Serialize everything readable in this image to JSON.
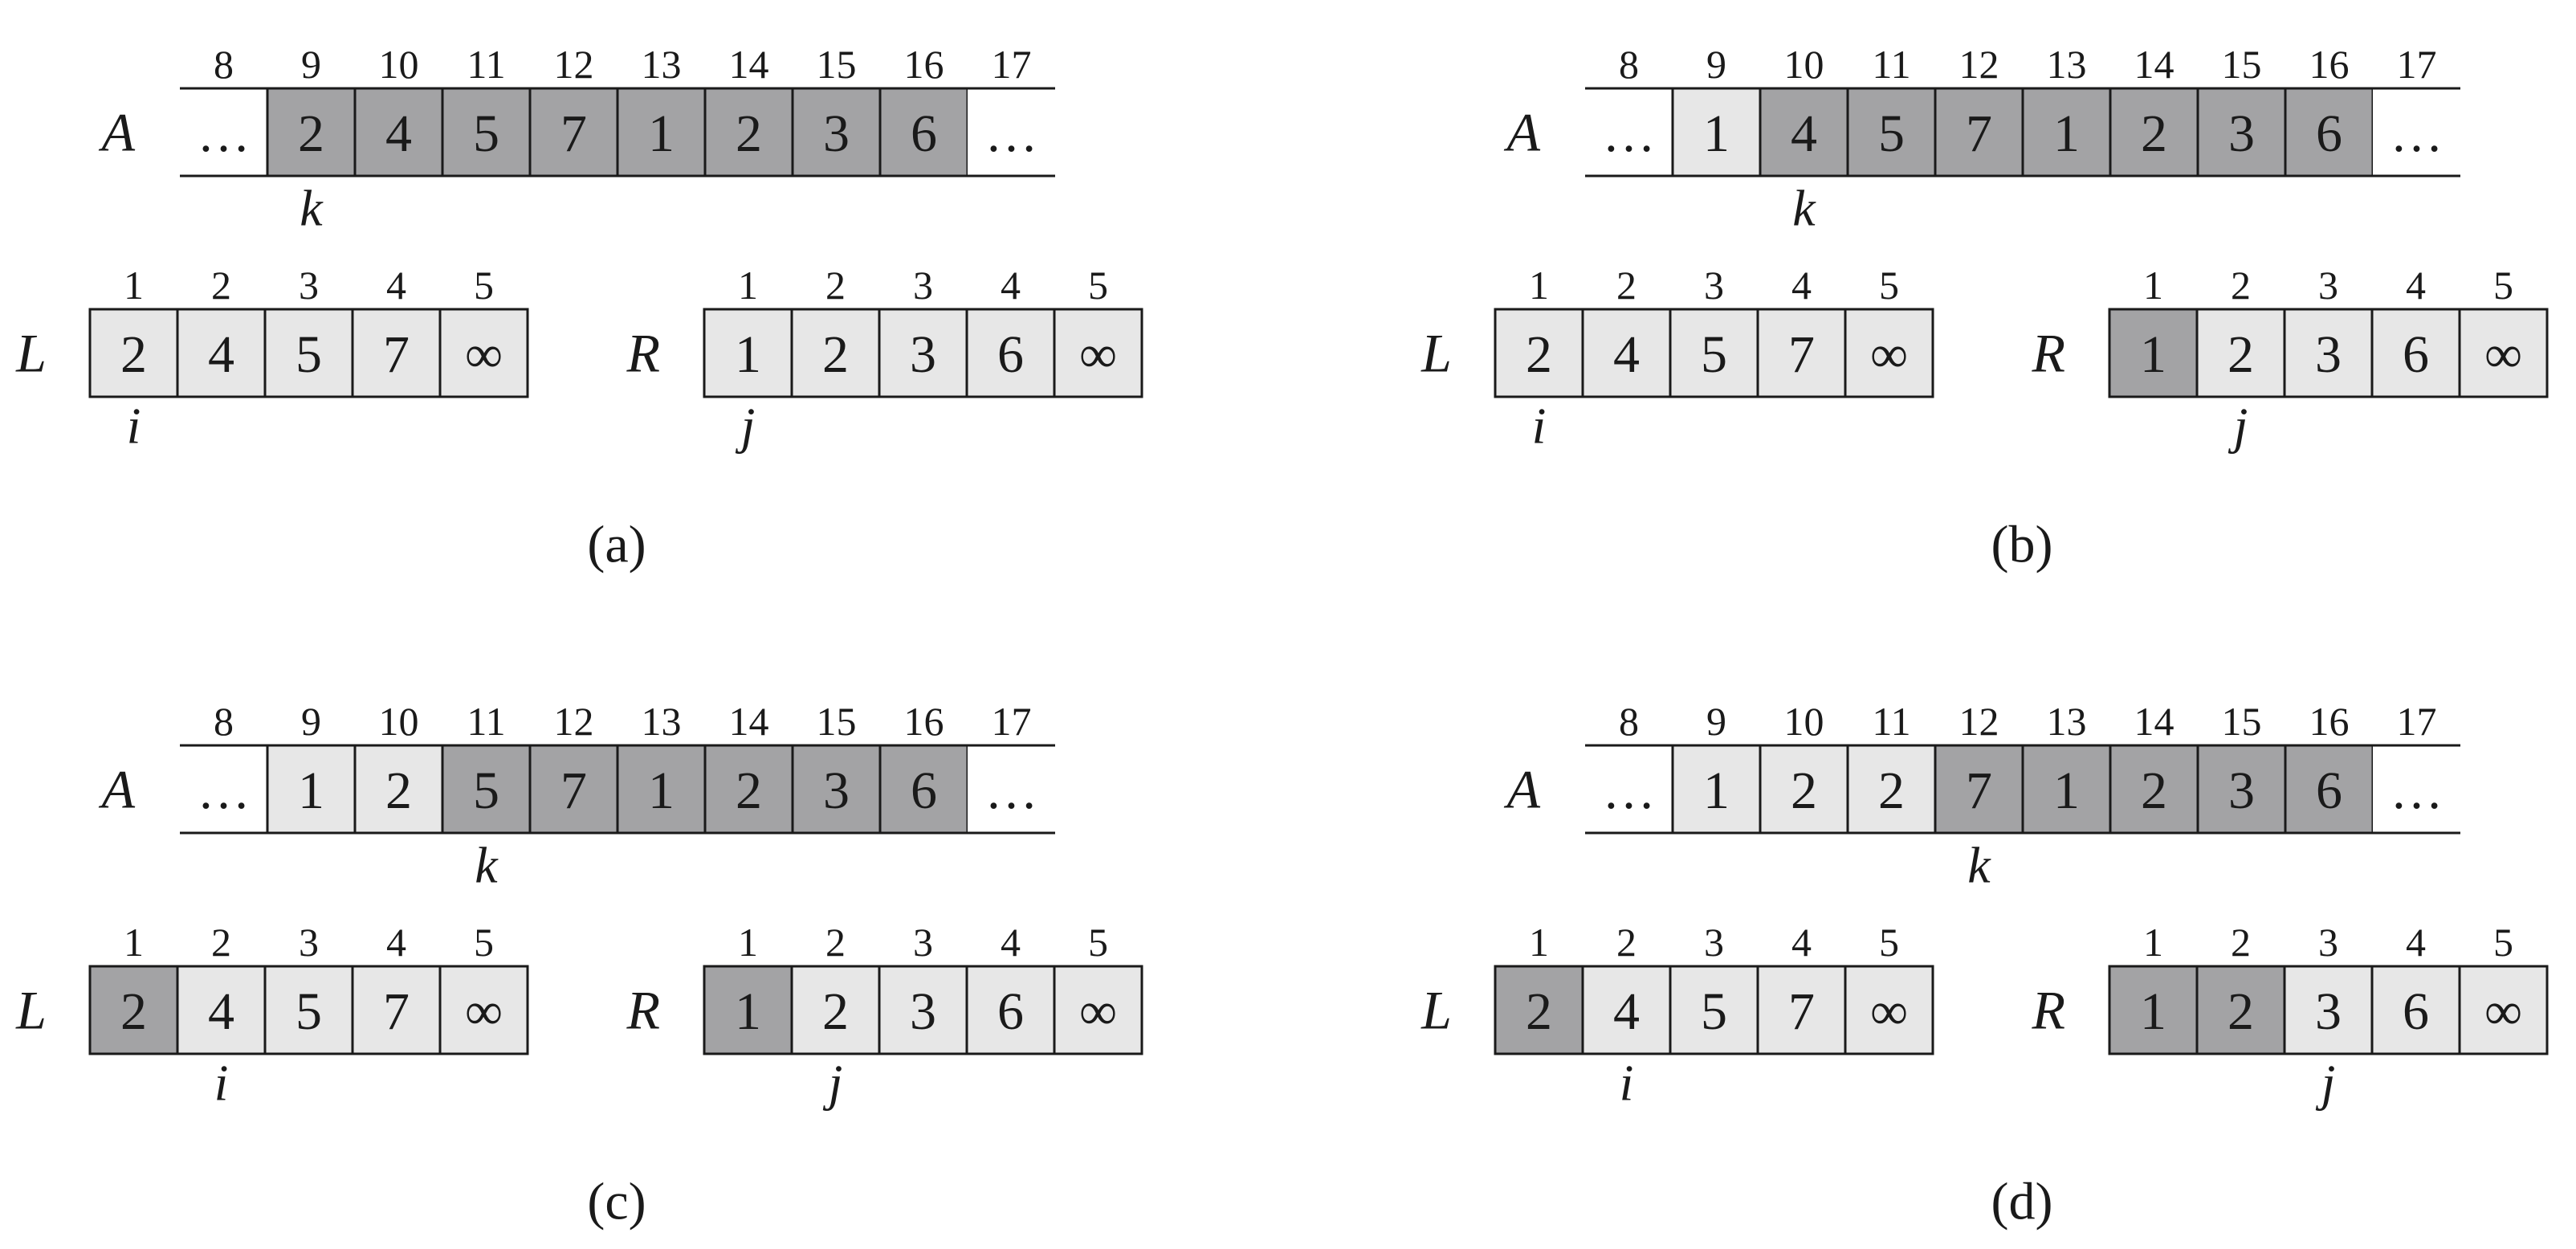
{
  "colors": {
    "dark": "#a3a3a5",
    "light": "#e7e7e7",
    "white": "#ffffff",
    "ink": "#1a1a1a"
  },
  "panels": [
    {
      "caption": "(a)",
      "A": {
        "name": "A",
        "indices": [
          "8",
          "9",
          "10",
          "11",
          "12",
          "13",
          "14",
          "15",
          "16",
          "17"
        ],
        "values": [
          "…",
          "2",
          "4",
          "5",
          "7",
          "1",
          "2",
          "3",
          "6",
          "…"
        ],
        "shades": [
          "white",
          "dark",
          "dark",
          "dark",
          "dark",
          "dark",
          "dark",
          "dark",
          "dark",
          "white"
        ],
        "pointer": {
          "label": "k",
          "cell": 1
        }
      },
      "L": {
        "name": "L",
        "indices": [
          "1",
          "2",
          "3",
          "4",
          "5"
        ],
        "values": [
          "2",
          "4",
          "5",
          "7",
          "∞"
        ],
        "shades": [
          "light",
          "light",
          "light",
          "light",
          "light"
        ],
        "pointer": {
          "label": "i",
          "cell": 0
        }
      },
      "R": {
        "name": "R",
        "indices": [
          "1",
          "2",
          "3",
          "4",
          "5"
        ],
        "values": [
          "1",
          "2",
          "3",
          "6",
          "∞"
        ],
        "shades": [
          "light",
          "light",
          "light",
          "light",
          "light"
        ],
        "pointer": {
          "label": "j",
          "cell": 0
        }
      }
    },
    {
      "caption": "(b)",
      "A": {
        "name": "A",
        "indices": [
          "8",
          "9",
          "10",
          "11",
          "12",
          "13",
          "14",
          "15",
          "16",
          "17"
        ],
        "values": [
          "…",
          "1",
          "4",
          "5",
          "7",
          "1",
          "2",
          "3",
          "6",
          "…"
        ],
        "shades": [
          "white",
          "light",
          "dark",
          "dark",
          "dark",
          "dark",
          "dark",
          "dark",
          "dark",
          "white"
        ],
        "pointer": {
          "label": "k",
          "cell": 2
        }
      },
      "L": {
        "name": "L",
        "indices": [
          "1",
          "2",
          "3",
          "4",
          "5"
        ],
        "values": [
          "2",
          "4",
          "5",
          "7",
          "∞"
        ],
        "shades": [
          "light",
          "light",
          "light",
          "light",
          "light"
        ],
        "pointer": {
          "label": "i",
          "cell": 0
        }
      },
      "R": {
        "name": "R",
        "indices": [
          "1",
          "2",
          "3",
          "4",
          "5"
        ],
        "values": [
          "1",
          "2",
          "3",
          "6",
          "∞"
        ],
        "shades": [
          "dark",
          "light",
          "light",
          "light",
          "light"
        ],
        "pointer": {
          "label": "j",
          "cell": 1
        }
      }
    },
    {
      "caption": "(c)",
      "A": {
        "name": "A",
        "indices": [
          "8",
          "9",
          "10",
          "11",
          "12",
          "13",
          "14",
          "15",
          "16",
          "17"
        ],
        "values": [
          "…",
          "1",
          "2",
          "5",
          "7",
          "1",
          "2",
          "3",
          "6",
          "…"
        ],
        "shades": [
          "white",
          "light",
          "light",
          "dark",
          "dark",
          "dark",
          "dark",
          "dark",
          "dark",
          "white"
        ],
        "pointer": {
          "label": "k",
          "cell": 3
        }
      },
      "L": {
        "name": "L",
        "indices": [
          "1",
          "2",
          "3",
          "4",
          "5"
        ],
        "values": [
          "2",
          "4",
          "5",
          "7",
          "∞"
        ],
        "shades": [
          "dark",
          "light",
          "light",
          "light",
          "light"
        ],
        "pointer": {
          "label": "i",
          "cell": 1
        }
      },
      "R": {
        "name": "R",
        "indices": [
          "1",
          "2",
          "3",
          "4",
          "5"
        ],
        "values": [
          "1",
          "2",
          "3",
          "6",
          "∞"
        ],
        "shades": [
          "dark",
          "light",
          "light",
          "light",
          "light"
        ],
        "pointer": {
          "label": "j",
          "cell": 1
        }
      }
    },
    {
      "caption": "(d)",
      "A": {
        "name": "A",
        "indices": [
          "8",
          "9",
          "10",
          "11",
          "12",
          "13",
          "14",
          "15",
          "16",
          "17"
        ],
        "values": [
          "…",
          "1",
          "2",
          "2",
          "7",
          "1",
          "2",
          "3",
          "6",
          "…"
        ],
        "shades": [
          "white",
          "light",
          "light",
          "light",
          "dark",
          "dark",
          "dark",
          "dark",
          "dark",
          "white"
        ],
        "pointer": {
          "label": "k",
          "cell": 4
        }
      },
      "L": {
        "name": "L",
        "indices": [
          "1",
          "2",
          "3",
          "4",
          "5"
        ],
        "values": [
          "2",
          "4",
          "5",
          "7",
          "∞"
        ],
        "shades": [
          "dark",
          "light",
          "light",
          "light",
          "light"
        ],
        "pointer": {
          "label": "i",
          "cell": 1
        }
      },
      "R": {
        "name": "R",
        "indices": [
          "1",
          "2",
          "3",
          "4",
          "5"
        ],
        "values": [
          "1",
          "2",
          "3",
          "6",
          "∞"
        ],
        "shades": [
          "dark",
          "dark",
          "light",
          "light",
          "light"
        ],
        "pointer": {
          "label": "j",
          "cell": 2
        }
      }
    }
  ]
}
